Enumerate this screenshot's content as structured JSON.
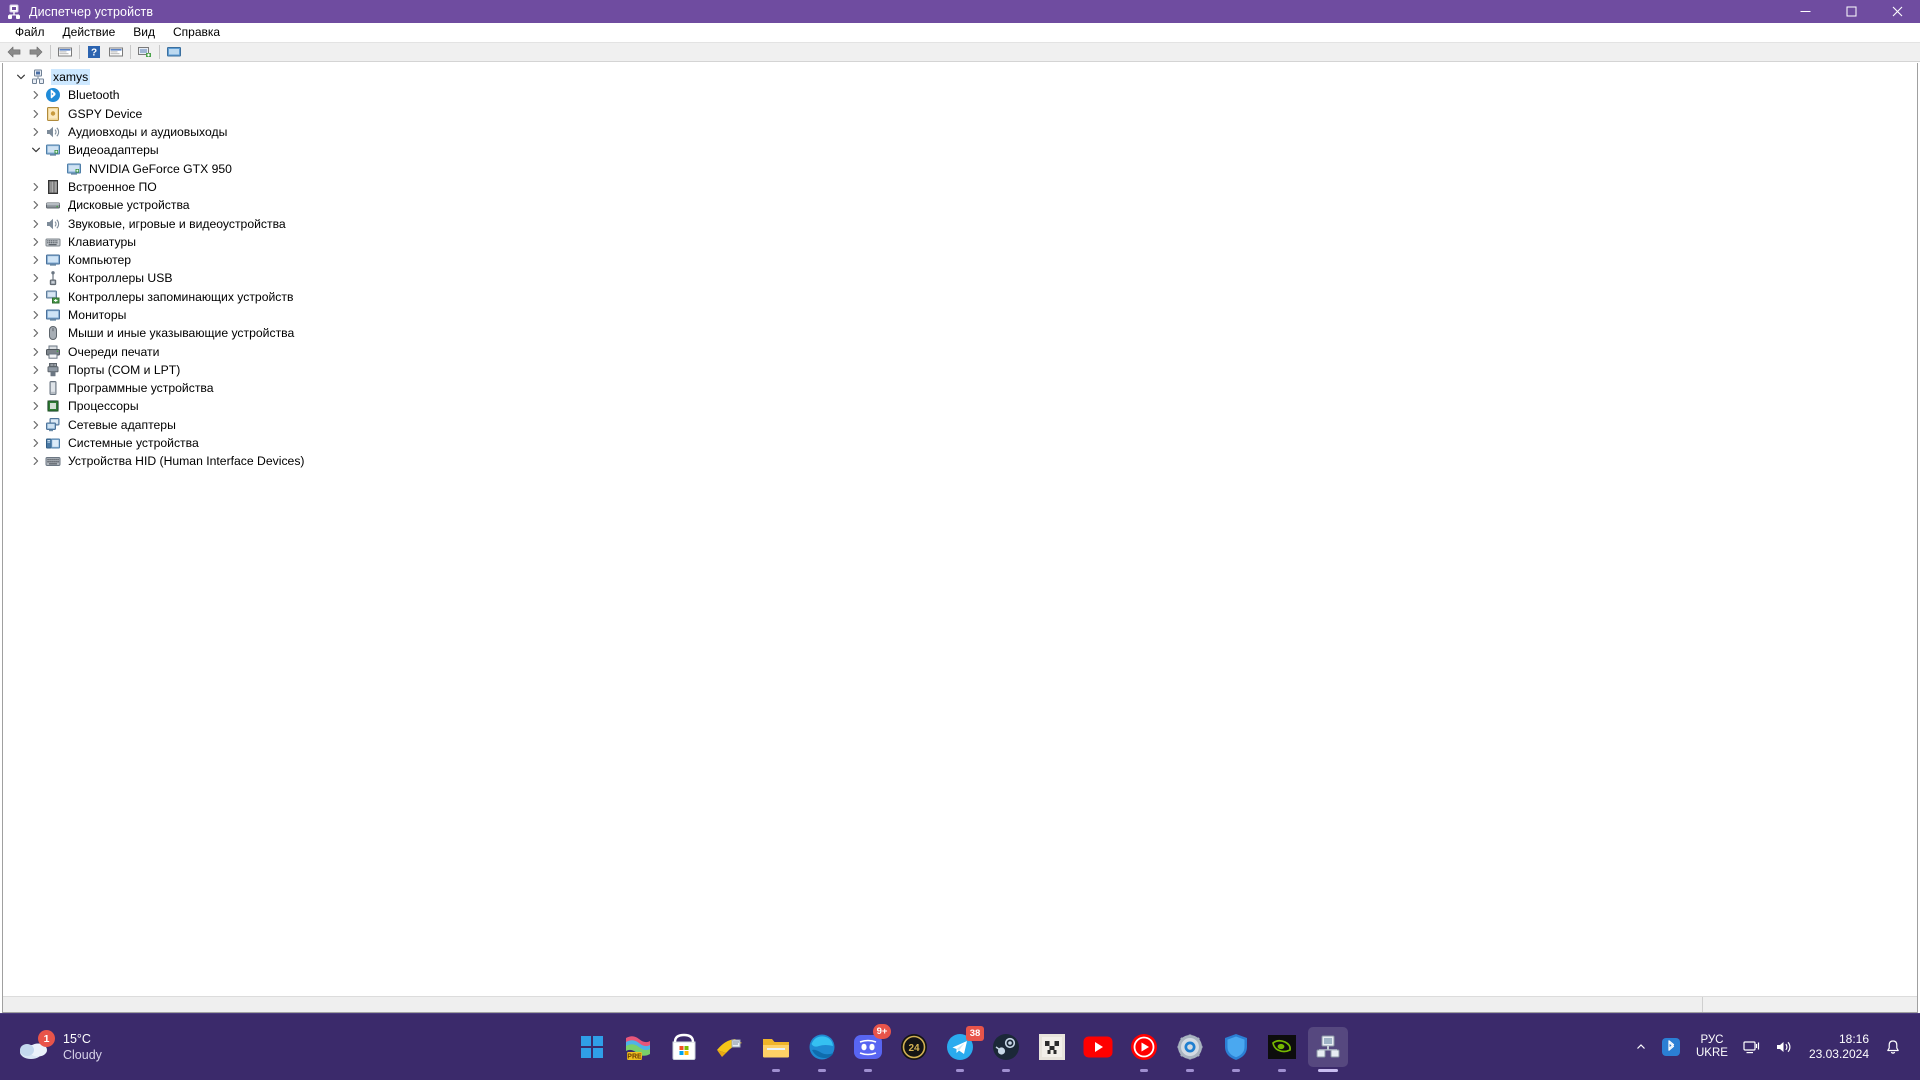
{
  "window": {
    "title": "Диспетчер устройств",
    "icon": "device-manager-icon",
    "minimize_label": "—",
    "maximize_label": "□",
    "close_label": "✕"
  },
  "menubar": {
    "items": [
      {
        "label": "Файл"
      },
      {
        "label": "Действие"
      },
      {
        "label": "Вид"
      },
      {
        "label": "Справка"
      }
    ]
  },
  "toolbar": {
    "buttons": [
      {
        "name": "back-arrow-icon",
        "title": "Назад"
      },
      {
        "name": "forward-arrow-icon",
        "title": "Вперед"
      },
      {
        "name": "properties-icon",
        "title": "Свойства"
      },
      {
        "name": "help-icon",
        "title": "Справка"
      },
      {
        "name": "update-driver-icon",
        "title": "Обновить драйвер"
      },
      {
        "name": "scan-hardware-icon",
        "title": "Обновить конфигурацию оборудования"
      },
      {
        "name": "show-devices-icon",
        "title": "Показать устройства"
      }
    ]
  },
  "tree": {
    "nodes": [
      {
        "label": "xamys",
        "icon": "computer-root-icon",
        "indent": 0,
        "expanded": true,
        "selected": true,
        "has_children": true
      },
      {
        "label": "Bluetooth",
        "icon": "bluetooth-icon",
        "indent": 1,
        "expanded": false,
        "selected": false,
        "has_children": true
      },
      {
        "label": "GSPY Device",
        "icon": "gspy-device-icon",
        "indent": 1,
        "expanded": false,
        "selected": false,
        "has_children": true
      },
      {
        "label": "Аудиовходы и аудиовыходы",
        "icon": "speaker-icon",
        "indent": 1,
        "expanded": false,
        "selected": false,
        "has_children": true
      },
      {
        "label": "Видеоадаптеры",
        "icon": "display-adapter-icon",
        "indent": 1,
        "expanded": true,
        "selected": false,
        "has_children": true
      },
      {
        "label": "NVIDIA GeForce GTX 950",
        "icon": "display-adapter-icon",
        "indent": 2,
        "expanded": false,
        "selected": false,
        "has_children": false
      },
      {
        "label": "Встроенное ПО",
        "icon": "firmware-icon",
        "indent": 1,
        "expanded": false,
        "selected": false,
        "has_children": true
      },
      {
        "label": "Дисковые устройства",
        "icon": "disk-drive-icon",
        "indent": 1,
        "expanded": false,
        "selected": false,
        "has_children": true
      },
      {
        "label": "Звуковые, игровые и видеоустройства",
        "icon": "speaker-icon",
        "indent": 1,
        "expanded": false,
        "selected": false,
        "has_children": true
      },
      {
        "label": "Клавиатуры",
        "icon": "keyboard-icon",
        "indent": 1,
        "expanded": false,
        "selected": false,
        "has_children": true
      },
      {
        "label": "Компьютер",
        "icon": "monitor-icon",
        "indent": 1,
        "expanded": false,
        "selected": false,
        "has_children": true
      },
      {
        "label": "Контроллеры USB",
        "icon": "usb-icon",
        "indent": 1,
        "expanded": false,
        "selected": false,
        "has_children": true
      },
      {
        "label": "Контроллеры запоминающих устройств",
        "icon": "storage-controller-icon",
        "indent": 1,
        "expanded": false,
        "selected": false,
        "has_children": true
      },
      {
        "label": "Мониторы",
        "icon": "monitor-icon",
        "indent": 1,
        "expanded": false,
        "selected": false,
        "has_children": true
      },
      {
        "label": "Мыши и иные указывающие устройства",
        "icon": "mouse-icon",
        "indent": 1,
        "expanded": false,
        "selected": false,
        "has_children": true
      },
      {
        "label": "Очереди печати",
        "icon": "printer-icon",
        "indent": 1,
        "expanded": false,
        "selected": false,
        "has_children": true
      },
      {
        "label": "Порты (COM и LPT)",
        "icon": "port-icon",
        "indent": 1,
        "expanded": false,
        "selected": false,
        "has_children": true
      },
      {
        "label": "Программные устройства",
        "icon": "software-device-icon",
        "indent": 1,
        "expanded": false,
        "selected": false,
        "has_children": true
      },
      {
        "label": "Процессоры",
        "icon": "processor-icon",
        "indent": 1,
        "expanded": false,
        "selected": false,
        "has_children": true
      },
      {
        "label": "Сетевые адаптеры",
        "icon": "network-adapter-icon",
        "indent": 1,
        "expanded": false,
        "selected": false,
        "has_children": true
      },
      {
        "label": "Системные устройства",
        "icon": "system-device-icon",
        "indent": 1,
        "expanded": false,
        "selected": false,
        "has_children": true
      },
      {
        "label": "Устройства HID (Human Interface Devices)",
        "icon": "hid-icon",
        "indent": 1,
        "expanded": false,
        "selected": false,
        "has_children": true
      }
    ]
  },
  "taskbar": {
    "weather": {
      "temperature": "15°C",
      "condition": "Cloudy",
      "badge": "1",
      "icon": "cloud-icon"
    },
    "apps": [
      {
        "name": "start-button",
        "label": "Пуск",
        "badge": null,
        "running": false,
        "active": false
      },
      {
        "name": "preview-app-icon",
        "label": "PRE",
        "badge": null,
        "running": false,
        "active": false
      },
      {
        "name": "microsoft-store-icon",
        "label": "Microsoft Store",
        "badge": null,
        "running": false,
        "active": false
      },
      {
        "name": "paint-icon",
        "label": "Paint",
        "badge": null,
        "running": false,
        "active": false
      },
      {
        "name": "file-explorer-icon",
        "label": "Проводник",
        "badge": null,
        "running": true,
        "active": false
      },
      {
        "name": "edge-icon",
        "label": "Microsoft Edge",
        "badge": null,
        "running": true,
        "active": false
      },
      {
        "name": "discord-icon",
        "label": "Discord",
        "badge": "9+",
        "running": true,
        "active": false
      },
      {
        "name": "twentyfour-icon",
        "label": "24",
        "badge": null,
        "running": false,
        "active": false
      },
      {
        "name": "telegram-icon",
        "label": "Telegram",
        "badge": "38",
        "running": true,
        "active": false
      },
      {
        "name": "steam-icon",
        "label": "Steam",
        "badge": null,
        "running": true,
        "active": false
      },
      {
        "name": "minecraft-icon",
        "label": "Minecraft",
        "badge": null,
        "running": false,
        "active": false
      },
      {
        "name": "youtube-icon",
        "label": "YouTube",
        "badge": null,
        "running": false,
        "active": false
      },
      {
        "name": "youtube-music-icon",
        "label": "YouTube Music",
        "badge": null,
        "running": true,
        "active": false
      },
      {
        "name": "settings-icon",
        "label": "Параметры",
        "badge": null,
        "running": true,
        "active": false
      },
      {
        "name": "windows-security-icon",
        "label": "Безопасность Windows",
        "badge": null,
        "running": true,
        "active": false
      },
      {
        "name": "nvidia-icon",
        "label": "NVIDIA",
        "badge": null,
        "running": true,
        "active": false
      },
      {
        "name": "device-manager-taskbar-icon",
        "label": "Диспетчер устройств",
        "badge": null,
        "running": true,
        "active": true
      }
    ],
    "tray": {
      "chevron": "⌃",
      "bluetooth": "bluetooth-icon",
      "language_top": "РУС",
      "language_bottom": "UKRE",
      "network": "network-icon",
      "volume": "volume-icon",
      "time": "18:16",
      "date": "23.03.2024",
      "notification": "bell-icon"
    }
  },
  "colors": {
    "titlebar": "#6f4ca0",
    "taskbar": "#3b2a6b",
    "selection": "#cde8ff",
    "badge": "#e8544a"
  }
}
